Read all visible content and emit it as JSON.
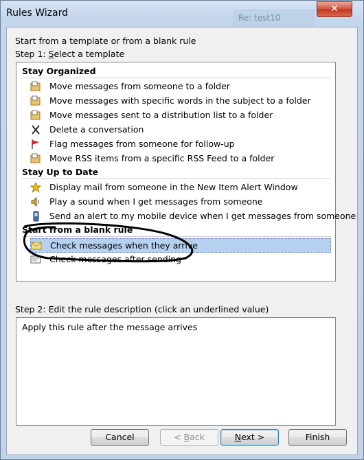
{
  "window": {
    "title": "Rules Wizard",
    "background_tab": "Re: test10",
    "close_glyph": "✕"
  },
  "intro": "Start from a template or from a blank rule",
  "step1": {
    "prefix": "Step 1: ",
    "underlined": "S",
    "rest": "elect a template"
  },
  "groups": [
    {
      "label": "Stay Organized",
      "items": [
        {
          "icon": "move-folder-icon",
          "label": "Move messages from someone to a folder"
        },
        {
          "icon": "move-folder-icon",
          "label": "Move messages with specific words in the subject to a folder"
        },
        {
          "icon": "move-folder-icon",
          "label": "Move messages sent to a distribution list to a folder"
        },
        {
          "icon": "delete-x-icon",
          "label": "Delete a conversation"
        },
        {
          "icon": "red-flag-icon",
          "label": "Flag messages from someone for follow-up"
        },
        {
          "icon": "move-folder-icon",
          "label": "Move RSS items from a specific RSS Feed to a folder"
        }
      ]
    },
    {
      "label": "Stay Up to Date",
      "items": [
        {
          "icon": "star-alert-icon",
          "label": "Display mail from someone in the New Item Alert Window"
        },
        {
          "icon": "speaker-icon",
          "label": "Play a sound when I get messages from someone"
        },
        {
          "icon": "mobile-phone-icon",
          "label": "Send an alert to my mobile device when I get messages from someone"
        }
      ]
    },
    {
      "label": "Start from a blank rule",
      "items": [
        {
          "icon": "envelope-icon",
          "label": "Check messages when they arrive",
          "selected": true
        },
        {
          "icon": "sent-envelope-icon",
          "label": "Check messages after sending"
        }
      ]
    }
  ],
  "step2": {
    "label": "Step 2: Edit the rule description (click an underlined value)"
  },
  "description": "Apply this rule after the message arrives",
  "buttons": {
    "cancel": "Cancel",
    "back_arrow": "< ",
    "back_ul": "B",
    "back_rest": "ack",
    "next_ul": "N",
    "next_rest": "ext >",
    "finish": "Finish"
  },
  "colors": {
    "selection": "#b6d1f0",
    "titlebar": "#c4d6ec",
    "close": "#c2321c"
  }
}
